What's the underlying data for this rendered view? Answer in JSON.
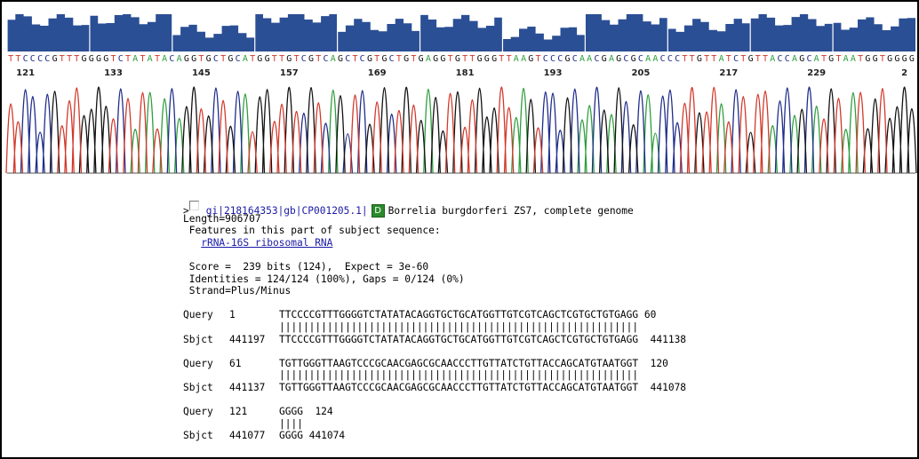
{
  "chromatogram": {
    "colors": {
      "A": "#2e9e3e",
      "C": "#1f2d8a",
      "G": "#111111",
      "T": "#d2382a"
    },
    "quality_bar_color": "#2b4f95",
    "base_calls": "TTCCCCGTTTGGGGTCTATATACAGGTGCTGCATGGTTGTCGTCAGCTCGTGCTGTGAGGTGTTGGGTTAAGTCCCGCAACGAGCGCAACCCTTGTTATCTGTTACCAGCATGTAATGGTGGGG",
    "position_labels": [
      "121",
      "133",
      "145",
      "157",
      "169",
      "181",
      "193",
      "205",
      "217",
      "229",
      "2"
    ],
    "quality_segments": [
      0.85,
      0.9,
      0.55,
      0.95,
      0.7,
      0.8,
      0.5,
      0.9,
      0.7,
      0.85,
      0.75
    ]
  },
  "hit": {
    "accession": "gi|218164353|gb|CP001205.1|",
    "badge": "D",
    "description": "Borrelia burgdorferi ZS7, complete genome",
    "length_line": "Length=906707",
    "features_line": " Features in this part of subject sequence:",
    "feature_link": "rRNA-16S ribosomal RNA",
    "score_line": " Score =  239 bits (124),  Expect = 3e-60",
    "identities_line": " Identities = 124/124 (100%), Gaps = 0/124 (0%)",
    "strand_line": " Strand=Plus/Minus"
  },
  "alignment": [
    {
      "q_label": "Query",
      "q_start": "1",
      "q_seq": "TTCCCCGTTTGGGGTCTATATACAGGTGCTGCATGGTTGTCGTCAGCTCGTGCTGTGAGG",
      "q_end": "60",
      "match": "||||||||||||||||||||||||||||||||||||||||||||||||||||||||||||",
      "s_label": "Sbjct",
      "s_start": "441197",
      "s_seq": "TTCCCCGTTTGGGGTCTATATACAGGTGCTGCATGGTTGTCGTCAGCTCGTGCTGTGAGG",
      "s_end": "441138"
    },
    {
      "q_label": "Query",
      "q_start": "61",
      "q_seq": "TGTTGGGTTAAGTCCCGCAACGAGCGCAACCCTTGTTATCTGTTACCAGCATGTAATGGT",
      "q_end": "120",
      "match": "||||||||||||||||||||||||||||||||||||||||||||||||||||||||||||",
      "s_label": "Sbjct",
      "s_start": "441137",
      "s_seq": "TGTTGGGTTAAGTCCCGCAACGAGCGCAACCCTTGTTATCTGTTACCAGCATGTAATGGT",
      "s_end": "441078"
    },
    {
      "q_label": "Query",
      "q_start": "121",
      "q_seq": "GGGG",
      "q_end": "124",
      "match": "||||",
      "s_label": "Sbjct",
      "s_start": "441077",
      "s_seq": "GGGG",
      "s_end": "441074"
    }
  ]
}
